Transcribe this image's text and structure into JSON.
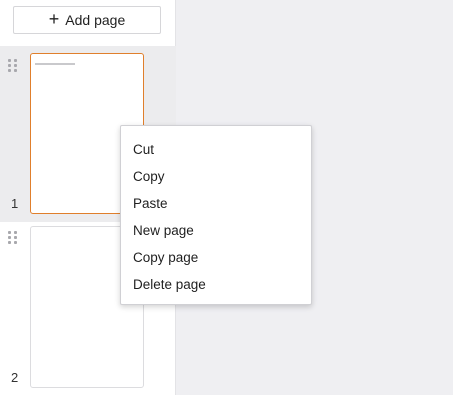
{
  "sidebar": {
    "add_page_label": "Add page",
    "pages": [
      {
        "number": "1"
      },
      {
        "number": "2"
      }
    ]
  },
  "context_menu": {
    "items": [
      "Cut",
      "Copy",
      "Paste",
      "New page",
      "Copy page",
      "Delete page"
    ]
  },
  "colors": {
    "selected_thumb_border": "#e07f2c",
    "canvas_background": "#efeff2"
  }
}
